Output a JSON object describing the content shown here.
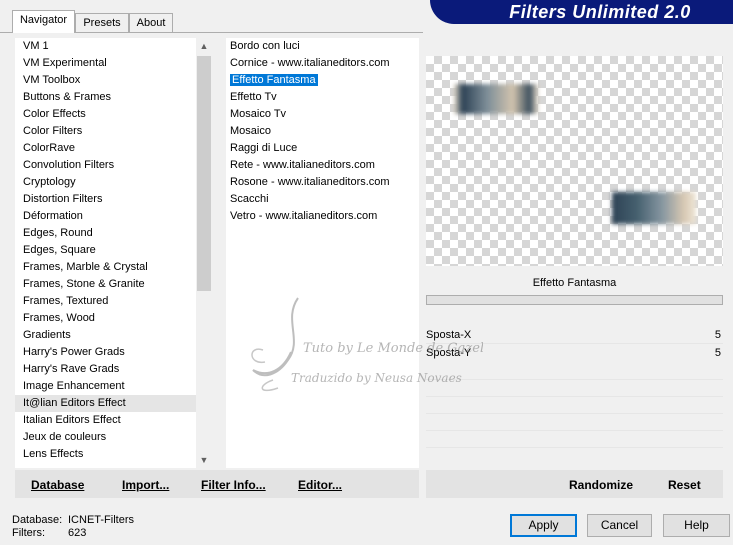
{
  "app": {
    "title": "Filters Unlimited 2.0"
  },
  "tabs": [
    {
      "label": "Navigator",
      "active": true
    },
    {
      "label": "Presets",
      "active": false
    },
    {
      "label": "About",
      "active": false
    }
  ],
  "categories": [
    "VM 1",
    "VM Experimental",
    "VM Toolbox",
    "Buttons & Frames",
    "Color Effects",
    "Color Filters",
    "ColorRave",
    "Convolution Filters",
    "Cryptology",
    "Distortion Filters",
    "Déformation",
    "Edges, Round",
    "Edges, Square",
    "Frames, Marble & Crystal",
    "Frames, Stone & Granite",
    "Frames, Textured",
    "Frames, Wood",
    "Gradients",
    "Harry's Power Grads",
    "Harry's Rave Grads",
    "Image Enhancement",
    "It@lian Editors Effect",
    "Italian Editors Effect",
    "Jeux de couleurs",
    "Lens Effects"
  ],
  "selected_category": "It@lian Editors Effect",
  "filters": [
    "Bordo con luci",
    "Cornice - www.italianeditors.com",
    "Effetto Fantasma",
    "Effetto Tv",
    "Mosaico Tv",
    "Mosaico",
    "Raggi di Luce",
    "Rete - www.italianeditors.com",
    "Rosone - www.italianeditors.com",
    "Scacchi",
    "Vetro - www.italianeditors.com"
  ],
  "selected_filter": "Effetto Fantasma",
  "params": {
    "filter_name": "Effetto Fantasma",
    "items": [
      {
        "label": "Sposta-X",
        "value": "5"
      },
      {
        "label": "Sposta-Y",
        "value": "5"
      }
    ]
  },
  "watermark": {
    "line1": "Tuto by Le Monde de Gazelle",
    "line2": "Traduzido by Neusa Novaes"
  },
  "bottom_buttons": {
    "database": "Database",
    "import": "Import...",
    "filter_info": "Filter Info...",
    "editor": "Editor...",
    "randomize": "Randomize",
    "reset": "Reset"
  },
  "status": {
    "database_label": "Database:",
    "database_value": "ICNET-Filters",
    "filters_label": "Filters:",
    "filters_value": "623"
  },
  "dialog_buttons": {
    "apply": "Apply",
    "cancel": "Cancel",
    "help": "Help"
  },
  "colors": {
    "accent": "#0078d7",
    "banner": "#0a1a7a"
  }
}
